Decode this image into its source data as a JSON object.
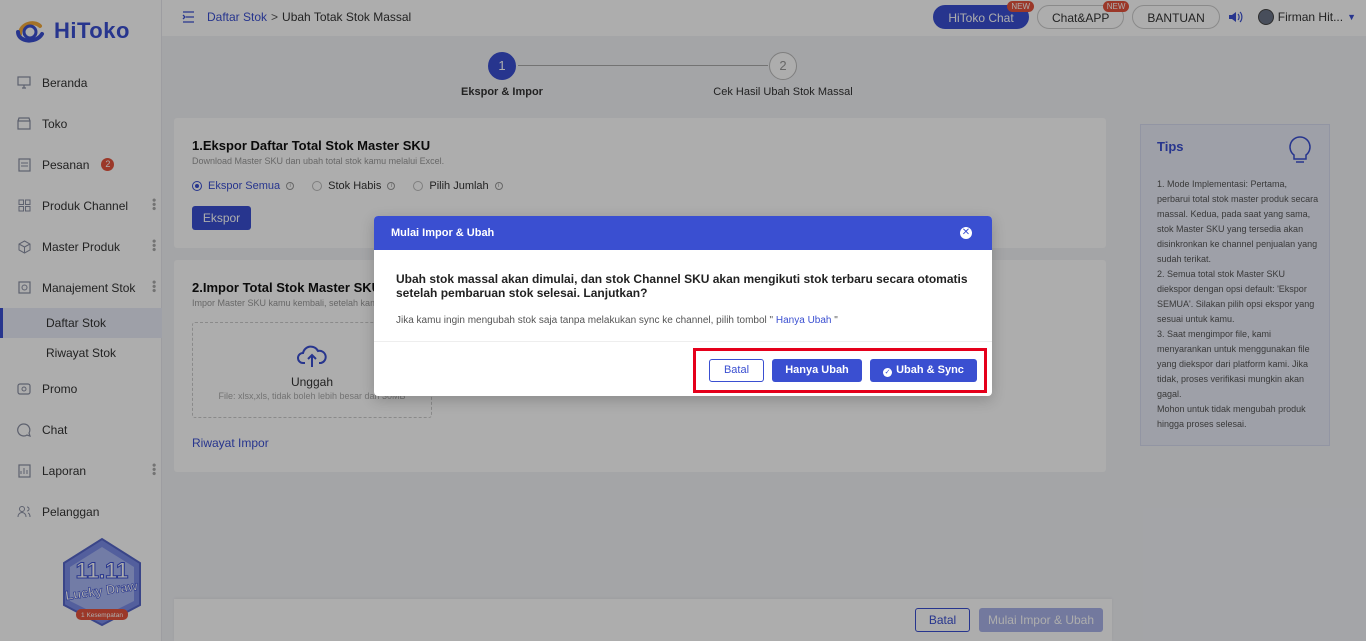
{
  "brand": {
    "name": "HiToko"
  },
  "sidebar": {
    "items": [
      {
        "label": "Beranda",
        "icon": "monitor-icon"
      },
      {
        "label": "Toko",
        "icon": "store-icon"
      },
      {
        "label": "Pesanan",
        "icon": "orders-icon",
        "badge": "2"
      },
      {
        "label": "Produk Channel",
        "icon": "grid-icon"
      },
      {
        "label": "Master Produk",
        "icon": "box-icon"
      },
      {
        "label": "Manajement Stok",
        "icon": "stock-icon"
      },
      {
        "label": "Promo",
        "icon": "promo-icon"
      },
      {
        "label": "Chat",
        "icon": "chat-icon"
      },
      {
        "label": "Laporan",
        "icon": "report-icon"
      },
      {
        "label": "Pelanggan",
        "icon": "customer-icon"
      }
    ],
    "sub_items": [
      {
        "label": "Daftar Stok"
      },
      {
        "label": "Riwayat Stok"
      }
    ],
    "promo": {
      "line1": "11.11",
      "line2": "Lucky Draw",
      "line3": "1 Kesempatan"
    }
  },
  "header": {
    "breadcrumb_link": "Daftar Stok",
    "breadcrumb_sep": ">",
    "breadcrumb_current": "Ubah Totak Stok Massal",
    "hitoko_chat": "HiToko Chat",
    "chat_app": "Chat&APP",
    "new_tag": "NEW",
    "help": "BANTUAN",
    "user": "Firman Hit..."
  },
  "stepper": {
    "step1_num": "1",
    "step1_label": "Ekspor & Impor",
    "step2_num": "2",
    "step2_label": "Cek Hasil Ubah Stok Massal"
  },
  "export_card": {
    "title": "1.Ekspor Daftar Total Stok Master SKU",
    "desc": "Download Master SKU dan ubah total stok kamu melalui Excel.",
    "options": [
      "Ekspor Semua",
      "Stok Habis",
      "Pilih Jumlah"
    ],
    "selected": "Ekspor Semua",
    "button": "Ekspor"
  },
  "import_card": {
    "title": "2.Impor Total Stok Master SKU",
    "desc": "Impor Master SKU kamu kembali, setelah kamu",
    "upload_label": "Unggah",
    "upload_hint": "File: xlsx,xls, tidak boleh lebih besar dari 30MB",
    "history_link": "Riwayat Impor"
  },
  "tips": {
    "title": "Tips",
    "body": "1. Mode Implementasi: Pertama, perbarui total stok master produk secara massal. Kedua, pada saat yang sama, stok Master SKU yang tersedia akan disinkronkan ke channel penjualan yang sudah terikat.\n2. Semua total stok Master SKU diekspor dengan opsi default: 'Ekspor SEMUA'. Silakan pilih opsi ekspor yang sesuai untuk kamu.\n3. Saat mengimpor file, kami menyarankan untuk menggunakan file yang diekspor dari platform kami. Jika tidak, proses verifikasi mungkin akan gagal.\nMohon untuk tidak mengubah produk hingga proses selesai."
  },
  "bottom_bar": {
    "cancel": "Batal",
    "start": "Mulai Impor & Ubah"
  },
  "modal": {
    "title": "Mulai Impor & Ubah",
    "message": "Ubah stok massal akan dimulai, dan stok Channel SKU akan mengikuti stok terbaru secara otomatis setelah pembaruan stok selesai. Lanjutkan?",
    "sub_prefix": "Jika kamu ingin mengubah stok saja tanpa melakukan sync ke channel, pilih tombol \"",
    "sub_link": " Hanya Ubah ",
    "sub_suffix": "\"",
    "cancel": "Batal",
    "only_update": "Hanya Ubah",
    "update_sync": "Ubah & Sync"
  },
  "colors": {
    "accent": "#3a4fd1",
    "badge": "#e5533d",
    "highlight": "#e5001b"
  }
}
